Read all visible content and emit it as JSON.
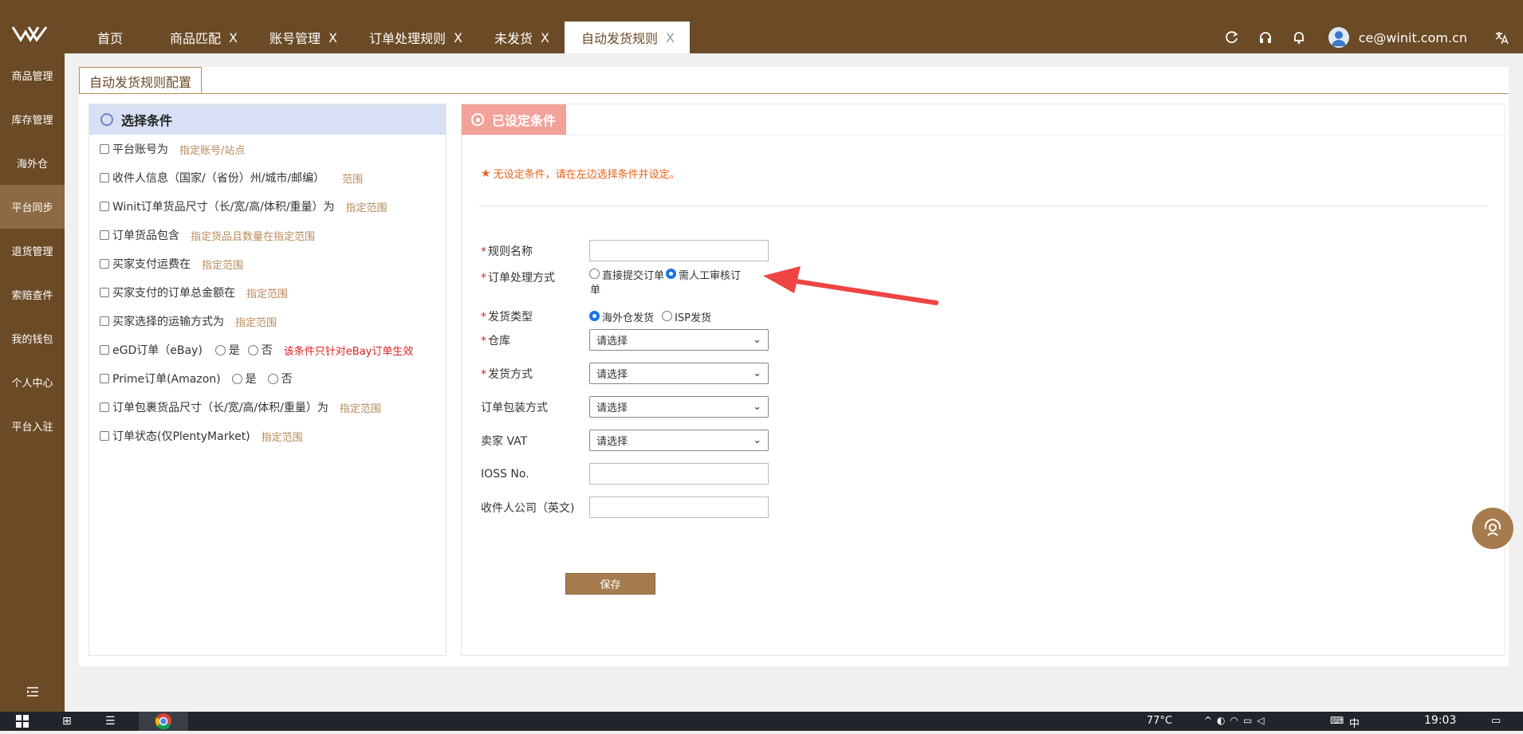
{
  "header": {
    "tabs": [
      {
        "label": "首页",
        "closable": false,
        "active": false
      },
      {
        "label": "商品匹配",
        "closable": true,
        "active": false
      },
      {
        "label": "账号管理",
        "closable": true,
        "active": false
      },
      {
        "label": "订单处理规则",
        "closable": true,
        "active": false
      },
      {
        "label": "未发货",
        "closable": true,
        "active": false
      },
      {
        "label": "自动发货规则",
        "closable": true,
        "active": true
      }
    ],
    "close_glyph": "X",
    "user_email": "ce@winit.com.cn",
    "icons": [
      "refresh-icon",
      "headset-icon",
      "bell-icon",
      "avatar",
      "translate-icon"
    ]
  },
  "sidebar": {
    "items": [
      {
        "label": "商品管理"
      },
      {
        "label": "库存管理"
      },
      {
        "label": "海外仓"
      },
      {
        "label": "平台同步",
        "active": true
      },
      {
        "label": "退货管理"
      },
      {
        "label": "索赔查件"
      },
      {
        "label": "我的钱包"
      },
      {
        "label": "个人中心"
      },
      {
        "label": "平台入驻"
      }
    ],
    "collapse_icon": "menu-collapse-icon"
  },
  "page": {
    "tab_label": "自动发货规则配置",
    "left": {
      "title": "选择条件",
      "conditions": [
        {
          "label": "平台账号为",
          "link": "指定账号/站点"
        },
        {
          "label": "收件人信息（国家/（省份）州/城市/邮编）",
          "link": "范围"
        },
        {
          "label": "Winit订单货品尺寸（长/宽/高/体积/重量）为",
          "link": "指定范围"
        },
        {
          "label": "订单货品包含",
          "link": "指定货品且数量在指定范围"
        },
        {
          "label": "买家支付运费在",
          "link": "指定范围"
        },
        {
          "label": "买家支付的订单总金额在",
          "link": "指定范围"
        },
        {
          "label": "买家选择的运输方式为",
          "link": "指定范围"
        },
        {
          "label": "eGD订单（eBay)",
          "yes": "是",
          "no": "否",
          "note": "该条件只针对eBay订单生效"
        },
        {
          "label": "Prime订单(Amazon)",
          "yes": "是",
          "no": "否"
        },
        {
          "label": "订单包裹货品尺寸（长/宽/高/体积/重量）为",
          "link": "指定范围"
        },
        {
          "label": "订单状态(仅PlentyMarket)",
          "link": "指定范围"
        }
      ]
    },
    "right": {
      "title": "已设定条件",
      "warning": "无设定条件，请在左边选择条件并设定。",
      "form": {
        "rule_name_label": "规则名称",
        "order_method_label": "订单处理方式",
        "order_method_opt1": "直接提交订单",
        "order_method_opt2_line1": "需人工审核订",
        "order_method_opt2_line2": "单",
        "ship_type_label": "发货类型",
        "ship_type_opt1": "海外仓发货",
        "ship_type_opt2": "ISP发货",
        "warehouse_label": "仓库",
        "ship_method_label": "发货方式",
        "pack_label": "订单包装方式",
        "vat_label": "卖家 VAT",
        "ioss_label": "IOSS No.",
        "company_label": "收件人公司（英文)",
        "select_placeholder": "请选择",
        "save_label": "保存"
      }
    }
  },
  "taskbar": {
    "temperature": "77°C",
    "time": "19:03",
    "ime": "中"
  },
  "colors": {
    "brand": "#6b4a26",
    "accent": "#a67c4f",
    "warning": "#e8641b",
    "arrow": "#ef4444"
  }
}
